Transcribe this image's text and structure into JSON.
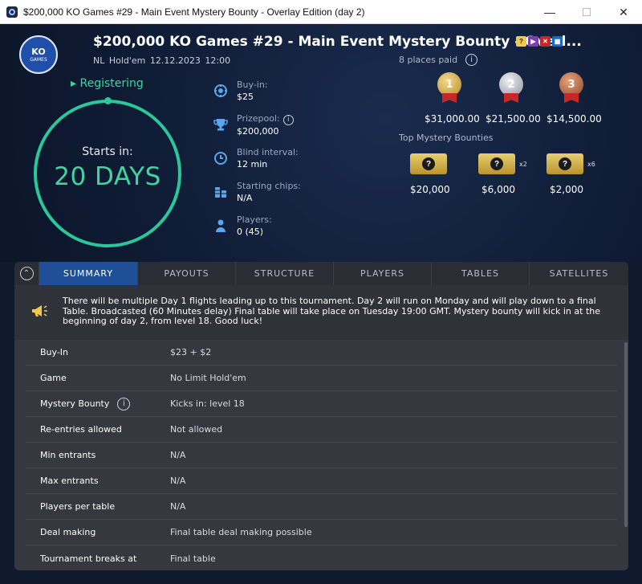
{
  "window": {
    "title": "$200,000 KO Games #29 - Main Event Mystery Bounty - Overlay Edition (day 2)",
    "minimize": "—",
    "close": "✕"
  },
  "header": {
    "logo_ko": "KO",
    "logo_games": "GAMES",
    "title": "$200,000 KO Games #29 - Main Event Mystery Bounty - Overl...",
    "game": "NL Hold'em",
    "date": "12.12.2023",
    "time": "12:00",
    "badges": {
      "question": "?",
      "video": "▶",
      "x": "✕",
      "calendar": "▦"
    }
  },
  "status": {
    "label": "▸ Registering",
    "starts_label": "Starts in:",
    "starts_value": "20 DAYS"
  },
  "details": [
    {
      "label": "Buy-in:",
      "value": "$25",
      "icon": "poker-chip-icon"
    },
    {
      "label": "Prizepool:",
      "value": "$200,000",
      "icon": "trophy-icon"
    },
    {
      "label": "Blind interval:",
      "value": "12 min",
      "icon": "clock-icon"
    },
    {
      "label": "Starting chips:",
      "value": "N/A",
      "icon": "chip-stack-icon"
    },
    {
      "label": "Players:",
      "value": "0 (45)",
      "icon": "person-icon"
    }
  ],
  "payouts": {
    "places_paid": "8 places paid",
    "places": [
      {
        "rank": "1",
        "amount": "$31,000.00",
        "color": "#c9a03c"
      },
      {
        "rank": "2",
        "amount": "$21,500.00",
        "color": "#b8bcc4"
      },
      {
        "rank": "3",
        "amount": "$14,500.00",
        "color": "#b56a45"
      }
    ]
  },
  "bounties": {
    "title": "Top Mystery Bounties",
    "items": [
      {
        "amount": "$20,000",
        "multiplier": ""
      },
      {
        "amount": "$6,000",
        "multiplier": "x2"
      },
      {
        "amount": "$2,000",
        "multiplier": "x6"
      }
    ]
  },
  "tabs": [
    "SUMMARY",
    "PAYOUTS",
    "STRUCTURE",
    "PLAYERS",
    "TABLES",
    "SATELLITES"
  ],
  "active_tab": "SUMMARY",
  "notice": "There will be multiple Day 1 flights leading up to this tournament. Day 2 will run on Monday and will play down to a final Table. Broadcasted (60 Minutes delay) Final table will take place on Tuesday 19:00 GMT. Mystery bounty will kick in at the beginning of day 2, from level 18. Good luck!",
  "summary_rows": [
    {
      "key": "Buy-In",
      "value": "$23 + $2"
    },
    {
      "key": "Game",
      "value": "No Limit Hold'em"
    },
    {
      "key": "Mystery Bounty",
      "value": "Kicks in: level 18"
    },
    {
      "key": "Re-entries allowed",
      "value": "Not allowed"
    },
    {
      "key": "Min entrants",
      "value": "N/A"
    },
    {
      "key": "Max entrants",
      "value": "N/A"
    },
    {
      "key": "Players per table",
      "value": "N/A"
    },
    {
      "key": "Deal making",
      "value": "Final table deal making possible"
    },
    {
      "key": "Tournament breaks at",
      "value": "Final table"
    }
  ],
  "colors": {
    "accent_green": "#3fd4a2",
    "tab_active": "#1f4f97",
    "background": "#0f1a2e",
    "panel": "#35383f"
  }
}
